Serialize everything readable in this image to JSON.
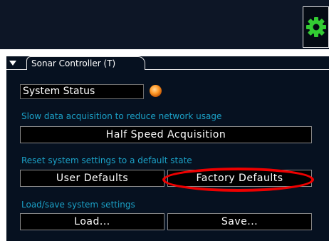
{
  "colors": {
    "top_bar": "#0d1626",
    "panel": "#061120",
    "caption_text": "#1ba1c7",
    "status_led": "#ff9a28",
    "gear": "#33cc33",
    "annotation_ellipse": "#ee0000"
  },
  "icons": {
    "settings": "gear-icon",
    "collapse": "triangle-down-icon",
    "status": "status-led-icon"
  },
  "tab": {
    "label": "Sonar Controller (T)"
  },
  "status": {
    "label": "System Status"
  },
  "acquisition": {
    "caption": "Slow data acquisition to reduce network usage",
    "button_label": "Half Speed Acquisition"
  },
  "reset": {
    "caption": "Reset system settings to a default state",
    "user_button_label": "User Defaults",
    "factory_button_label": "Factory Defaults"
  },
  "load_save": {
    "caption": "Load/save system settings",
    "load_button_label": "Load...",
    "save_button_label": "Save..."
  }
}
